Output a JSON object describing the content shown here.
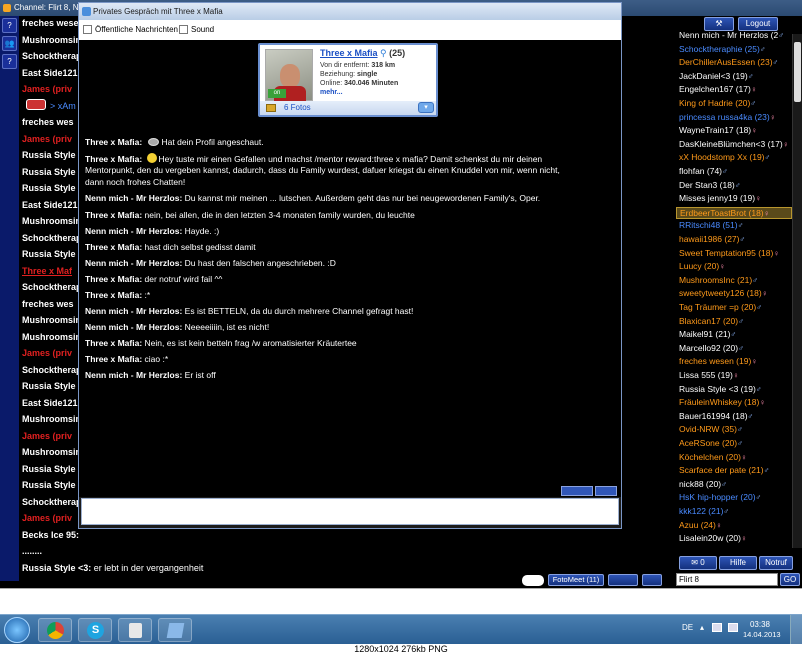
{
  "window": {
    "title": "Channel: Flirt 8,  N"
  },
  "left_tools": [
    "?",
    "👥",
    "?"
  ],
  "channel_lines": [
    {
      "text": "freches wesen",
      "style": "white"
    },
    {
      "text": "Mushroomsin",
      "style": "white"
    },
    {
      "text": "Schocktherap",
      "style": "white"
    },
    {
      "text": "East Side121",
      "style": "white"
    },
    {
      "text": "James (priv",
      "style": "red"
    },
    {
      "text": "> xAm",
      "style": "blue"
    },
    {
      "text": "freches wes",
      "style": "white"
    },
    {
      "text": "James (priv",
      "style": "red"
    },
    {
      "text": "Russia Style",
      "style": "white"
    },
    {
      "text": "Russia Style",
      "style": "white"
    },
    {
      "text": "Russia Style",
      "style": "white"
    },
    {
      "text": "East Side121",
      "style": "white"
    },
    {
      "text": "Mushroomsin",
      "style": "white"
    },
    {
      "text": "Schocktherap",
      "style": "white"
    },
    {
      "text": "Russia Style",
      "style": "white"
    },
    {
      "text": "Three x Maf",
      "style": "redu"
    },
    {
      "text": "Schocktherap",
      "style": "white"
    },
    {
      "text": "freches wes",
      "style": "white"
    },
    {
      "text": "Mushroomsin",
      "style": "white"
    },
    {
      "text": "Mushroomsin",
      "style": "white"
    },
    {
      "text": "James (priv",
      "style": "red"
    },
    {
      "text": "Schocktherap",
      "style": "white"
    },
    {
      "text": "Russia Style",
      "style": "white"
    },
    {
      "text": "East Side121",
      "style": "white"
    },
    {
      "text": "Mushroomsin",
      "style": "white"
    },
    {
      "text": "James (priv",
      "style": "red"
    },
    {
      "text": "Mushroomsin",
      "style": "white"
    },
    {
      "text": "Russia Style",
      "style": "white"
    },
    {
      "text": "Russia Style",
      "style": "white"
    },
    {
      "text": "Schocktherap",
      "style": "white"
    },
    {
      "text": "James (priv",
      "style": "red"
    },
    {
      "text": "Becks Ice 95:",
      "style": "white"
    },
    {
      "text": "........",
      "style": "white"
    },
    {
      "text": "Russia Style <3:",
      "style": "white",
      "rest": " er lebt in der vergangenheit"
    }
  ],
  "pm": {
    "title": "Privates Gespräch mit Three x Mafia",
    "opt_public": "Öffentliche Nachrichten",
    "opt_sound": "Sound",
    "profile": {
      "name": "Three x Mafia",
      "age": "(25)",
      "distance_label": "Von dir entfernt:",
      "distance": "318 km",
      "relation_label": "Beziehung:",
      "relation": "single",
      "online_label": "Online:",
      "online": "340.046 Minuten",
      "more": "mehr...",
      "photos": "6 Fotos",
      "badge": "on"
    },
    "messages": [
      {
        "who": "Three x Mafia:",
        "text": "Hat dein Profil angeschaut.",
        "icon": "eye"
      },
      {
        "who": "Three x Mafia:",
        "text": "Hey  tuste mir einen Gefallen und machst /mentor reward:three x mafia? Damit schenkst du mir deinen",
        "icon": "smile"
      },
      {
        "who": "",
        "text": "Mentorpunkt, den du vergeben kannst, dadurch, dass du Family wurdest, dafuer kriegst du einen Knuddel von mir, wenn nicht,"
      },
      {
        "who": "",
        "text": "dann noch frohes Chatten!"
      },
      {
        "who": "Nenn mich - Mr Herzlos:",
        "text": "Du kannst mir meinen ... lutschen. Außerdem geht das nur bei neugewordenen Family's, Oper."
      },
      {
        "who": "Three x Mafia:",
        "text": "nein, bei allen, die in den letzten 3-4 monaten family wurden, du leuchte"
      },
      {
        "who": "Nenn mich - Mr Herzlos:",
        "text": "Hayde. :)"
      },
      {
        "who": "Three x Mafia:",
        "text": "hast dich selbst gedisst damit"
      },
      {
        "who": "Nenn mich - Mr Herzlos:",
        "text": "Du hast den falschen angeschrieben. :D"
      },
      {
        "who": "Three x Mafia:",
        "text": "der notruf wird fail ^^"
      },
      {
        "who": "Three x Mafia:",
        "text": ":*"
      },
      {
        "who": "Nenn mich - Mr Herzlos:",
        "text": "Es ist BETTELN, da du durch mehrere Channel gefragt hast!"
      },
      {
        "who": "Nenn mich - Mr Herzlos:",
        "text": "Neeeeiiiin, ist es nicht!"
      },
      {
        "who": "Three x Mafia:",
        "text": "Nein, es ist kein betteln frag  /w aromatisierter Kräutertee"
      },
      {
        "who": "Three x Mafia:",
        "text": "ciao :*"
      },
      {
        "who": "Nenn mich - Mr Herzlos:",
        "text": "Er ist off"
      }
    ]
  },
  "top_right": {
    "logout": "Logout"
  },
  "users": [
    {
      "name": "Nenn mich - Mr Herzlos (2",
      "color": "#ffffff",
      "gender": "♂"
    },
    {
      "name": "Schocktheraphie (25)",
      "color": "#4a8bff",
      "gender": "♂"
    },
    {
      "name": "DerChillerAusEssen (23)",
      "color": "#ff9a1a",
      "gender": "♂"
    },
    {
      "name": "JackDaniel<3 (19)",
      "color": "#ffffff",
      "gender": "♂"
    },
    {
      "name": "Engelchen167 (17)",
      "color": "#ffffff",
      "gender": "♀"
    },
    {
      "name": "King of Hadrie (20)",
      "color": "#ff9a1a",
      "gender": "♂"
    },
    {
      "name": "princessa russa4ka (23)",
      "color": "#4a8bff",
      "gender": "♀"
    },
    {
      "name": "WayneTrain17 (18)",
      "color": "#ffffff",
      "gender": "♀"
    },
    {
      "name": "DasKleineBlümchen<3 (17)",
      "color": "#ffffff",
      "gender": "♀"
    },
    {
      "name": "xX Hoodstomp Xx (19)",
      "color": "#ff9a1a",
      "gender": "♂"
    },
    {
      "name": "flohfan (74)",
      "color": "#ffffff",
      "gender": "♂"
    },
    {
      "name": "Der Stan3 (18)",
      "color": "#ffffff",
      "gender": "♂"
    },
    {
      "name": "Misses jenny19 (19)",
      "color": "#ffffff",
      "gender": "♀"
    },
    {
      "name": "ErdbeerToastBrot (18)",
      "color": "#ff9a1a",
      "gender": "♀"
    },
    {
      "name": "RRitschi48 (51)",
      "color": "#4a8bff",
      "gender": "♂"
    },
    {
      "name": "hawaii1986 (27)",
      "color": "#ff9a1a",
      "gender": "♂"
    },
    {
      "name": "Sweet Temptation95 (18)",
      "color": "#ff9a1a",
      "gender": "♀"
    },
    {
      "name": "Luucy (20)",
      "color": "#ff9a1a",
      "gender": "♀"
    },
    {
      "name": "MushroomsInc (21)",
      "color": "#ff9a1a",
      "gender": "♂"
    },
    {
      "name": "sweetytweety126 (18)",
      "color": "#ff9a1a",
      "gender": "♀"
    },
    {
      "name": "Tag Träumer =p (20)",
      "color": "#ff9a1a",
      "gender": "♂"
    },
    {
      "name": "Blaxican17 (20)",
      "color": "#ff9a1a",
      "gender": "♂"
    },
    {
      "name": "Maikel91 (21)",
      "color": "#ffffff",
      "gender": "♂"
    },
    {
      "name": "Marcello92 (20)",
      "color": "#ffffff",
      "gender": "♂"
    },
    {
      "name": "freches wesen (19)",
      "color": "#ff9a1a",
      "gender": "♀"
    },
    {
      "name": "Lissa 555 (19)",
      "color": "#ffffff",
      "gender": "♀"
    },
    {
      "name": "Russia Style <3 (19)",
      "color": "#ffffff",
      "gender": "♂"
    },
    {
      "name": "FräuleinWhiskey (18)",
      "color": "#ff9a1a",
      "gender": "♀"
    },
    {
      "name": "Bauer161994 (18)",
      "color": "#ffffff",
      "gender": "♂"
    },
    {
      "name": "Ovid-NRW (35)",
      "color": "#ff9a1a",
      "gender": "♂"
    },
    {
      "name": "AceRSone (20)",
      "color": "#ff9a1a",
      "gender": "♂"
    },
    {
      "name": "Köchelchen (20)",
      "color": "#ff9a1a",
      "gender": "♀"
    },
    {
      "name": "Scarface der pate (21)",
      "color": "#ff9a1a",
      "gender": "♂"
    },
    {
      "name": "nick88 (20)",
      "color": "#ffffff",
      "gender": "♂"
    },
    {
      "name": "HsK hip-hopper (20)",
      "color": "#4a8bff",
      "gender": "♂"
    },
    {
      "name": "kkk122 (21)",
      "color": "#4a8bff",
      "gender": "♂"
    },
    {
      "name": "Azuu (24)",
      "color": "#ff9a1a",
      "gender": "♀"
    },
    {
      "name": "Lisalein20w (20)",
      "color": "#ffffff",
      "gender": "♀"
    }
  ],
  "right_buttons": {
    "hilfe": "Hilfe",
    "notruf": "Notruf",
    "mail_count": "0",
    "channel": "Flirt 8",
    "go": "GO"
  },
  "bottom": {
    "fotomeet": "FotoMeet (11)"
  },
  "tray": {
    "lang": "DE",
    "time": "03:38",
    "date": "14.04.2013"
  },
  "caption": "1280x1024  276kb  PNG"
}
